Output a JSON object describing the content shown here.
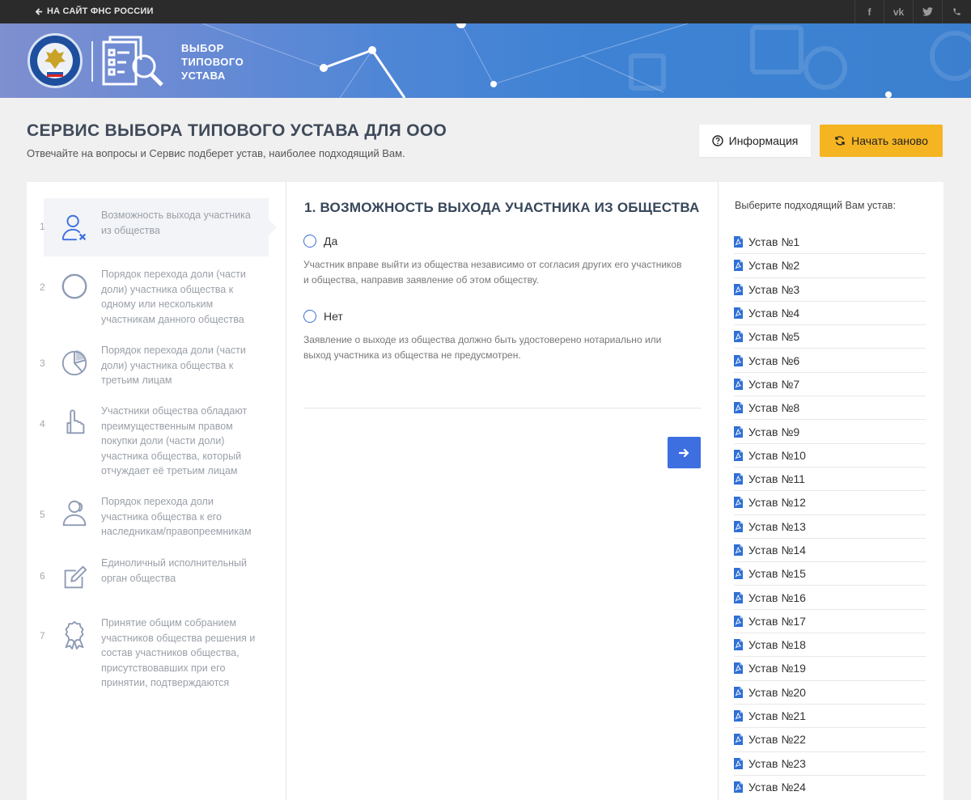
{
  "topbar": {
    "back_link": "НА САЙТ ФНС РОССИИ",
    "social": [
      "facebook-icon",
      "vk-icon",
      "twitter-icon",
      "phone-icon"
    ]
  },
  "banner": {
    "title_line1": "ВЫБОР",
    "title_line2": "ТИПОВОГО",
    "title_line3": "УСТАВА"
  },
  "header": {
    "title": "СЕРВИС ВЫБОРА ТИПОВОГО УСТАВА ДЛЯ ООО",
    "subtitle": "Отвечайте на вопросы и Сервис подберет устав, наиболее подходящий Вам.",
    "info_button": "Информация",
    "restart_button": "Начать заново"
  },
  "steps": [
    {
      "num": "1",
      "label": "Возможность выхода участника из общества",
      "icon": "user-x-icon"
    },
    {
      "num": "2",
      "label": "Порядок перехода доли (части доли) участника общества к одному или нескольким участникам данного общества",
      "icon": "circle-icon"
    },
    {
      "num": "3",
      "label": "Порядок перехода доли (части доли) участника общества к третьим лицам",
      "icon": "pie-chart-icon"
    },
    {
      "num": "4",
      "label": "Участники общества обладают преимущественным правом покупки доли (части доли) участника общества, который отчуждает её третьим лицам",
      "icon": "hand-pointer-icon"
    },
    {
      "num": "5",
      "label": "Порядок перехода доли участника общества к его наследникам/правопреемникам",
      "icon": "users-icon"
    },
    {
      "num": "6",
      "label": "Единоличный исполнительный орган общества",
      "icon": "edit-icon"
    },
    {
      "num": "7",
      "label": "Принятие общим собранием участников общества решения и состав участников общества, присутствовавших при его принятии, подтверждаются",
      "icon": "award-icon"
    }
  ],
  "question": {
    "title": "1. ВОЗМОЖНОСТЬ ВЫХОДА УЧАСТНИКА ИЗ ОБЩЕСТВА",
    "options": [
      {
        "label": "Да",
        "description": "Участник вправе выйти из общества независимо от согласия других его участников и общества, направив заявление об этом обществу."
      },
      {
        "label": "Нет",
        "description": "Заявление о выходе из общества должно быть удостоверено нотариально или выход участника из общества не предусмотрен."
      }
    ]
  },
  "ustav_panel": {
    "heading": "Выберите подходящий Вам устав:",
    "items": [
      "Устав №1",
      "Устав №2",
      "Устав №3",
      "Устав №4",
      "Устав №5",
      "Устав №6",
      "Устав №7",
      "Устав №8",
      "Устав №9",
      "Устав №10",
      "Устав №11",
      "Устав №12",
      "Устав №13",
      "Устав №14",
      "Устав №15",
      "Устав №16",
      "Устав №17",
      "Устав №18",
      "Устав №19",
      "Устав №20",
      "Устав №21",
      "Устав №22",
      "Устав №23",
      "Устав №24"
    ]
  },
  "colors": {
    "accent_blue": "#3d6fe1",
    "restart_yellow": "#f5b422",
    "pdf_blue": "#2f6fd6"
  }
}
